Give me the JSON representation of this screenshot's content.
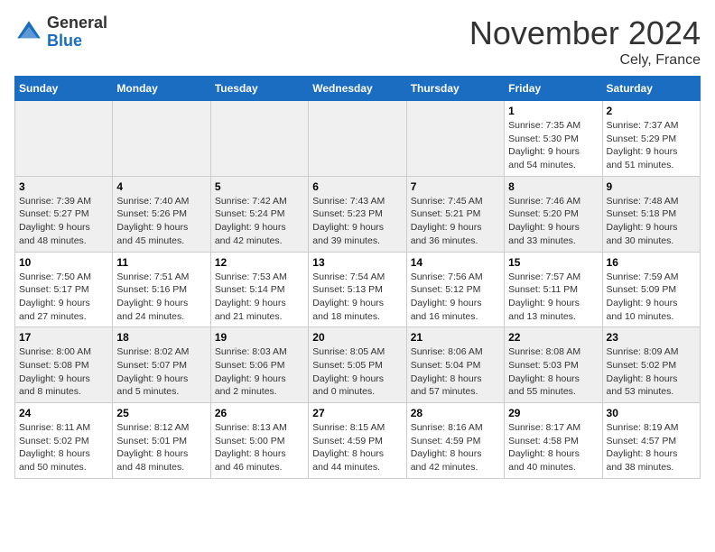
{
  "header": {
    "logo_general": "General",
    "logo_blue": "Blue",
    "month": "November 2024",
    "location": "Cely, France"
  },
  "days_of_week": [
    "Sunday",
    "Monday",
    "Tuesday",
    "Wednesday",
    "Thursday",
    "Friday",
    "Saturday"
  ],
  "weeks": [
    [
      {
        "day": "",
        "info": ""
      },
      {
        "day": "",
        "info": ""
      },
      {
        "day": "",
        "info": ""
      },
      {
        "day": "",
        "info": ""
      },
      {
        "day": "",
        "info": ""
      },
      {
        "day": "1",
        "info": "Sunrise: 7:35 AM\nSunset: 5:30 PM\nDaylight: 9 hours\nand 54 minutes."
      },
      {
        "day": "2",
        "info": "Sunrise: 7:37 AM\nSunset: 5:29 PM\nDaylight: 9 hours\nand 51 minutes."
      }
    ],
    [
      {
        "day": "3",
        "info": "Sunrise: 7:39 AM\nSunset: 5:27 PM\nDaylight: 9 hours\nand 48 minutes."
      },
      {
        "day": "4",
        "info": "Sunrise: 7:40 AM\nSunset: 5:26 PM\nDaylight: 9 hours\nand 45 minutes."
      },
      {
        "day": "5",
        "info": "Sunrise: 7:42 AM\nSunset: 5:24 PM\nDaylight: 9 hours\nand 42 minutes."
      },
      {
        "day": "6",
        "info": "Sunrise: 7:43 AM\nSunset: 5:23 PM\nDaylight: 9 hours\nand 39 minutes."
      },
      {
        "day": "7",
        "info": "Sunrise: 7:45 AM\nSunset: 5:21 PM\nDaylight: 9 hours\nand 36 minutes."
      },
      {
        "day": "8",
        "info": "Sunrise: 7:46 AM\nSunset: 5:20 PM\nDaylight: 9 hours\nand 33 minutes."
      },
      {
        "day": "9",
        "info": "Sunrise: 7:48 AM\nSunset: 5:18 PM\nDaylight: 9 hours\nand 30 minutes."
      }
    ],
    [
      {
        "day": "10",
        "info": "Sunrise: 7:50 AM\nSunset: 5:17 PM\nDaylight: 9 hours\nand 27 minutes."
      },
      {
        "day": "11",
        "info": "Sunrise: 7:51 AM\nSunset: 5:16 PM\nDaylight: 9 hours\nand 24 minutes."
      },
      {
        "day": "12",
        "info": "Sunrise: 7:53 AM\nSunset: 5:14 PM\nDaylight: 9 hours\nand 21 minutes."
      },
      {
        "day": "13",
        "info": "Sunrise: 7:54 AM\nSunset: 5:13 PM\nDaylight: 9 hours\nand 18 minutes."
      },
      {
        "day": "14",
        "info": "Sunrise: 7:56 AM\nSunset: 5:12 PM\nDaylight: 9 hours\nand 16 minutes."
      },
      {
        "day": "15",
        "info": "Sunrise: 7:57 AM\nSunset: 5:11 PM\nDaylight: 9 hours\nand 13 minutes."
      },
      {
        "day": "16",
        "info": "Sunrise: 7:59 AM\nSunset: 5:09 PM\nDaylight: 9 hours\nand 10 minutes."
      }
    ],
    [
      {
        "day": "17",
        "info": "Sunrise: 8:00 AM\nSunset: 5:08 PM\nDaylight: 9 hours\nand 8 minutes."
      },
      {
        "day": "18",
        "info": "Sunrise: 8:02 AM\nSunset: 5:07 PM\nDaylight: 9 hours\nand 5 minutes."
      },
      {
        "day": "19",
        "info": "Sunrise: 8:03 AM\nSunset: 5:06 PM\nDaylight: 9 hours\nand 2 minutes."
      },
      {
        "day": "20",
        "info": "Sunrise: 8:05 AM\nSunset: 5:05 PM\nDaylight: 9 hours\nand 0 minutes."
      },
      {
        "day": "21",
        "info": "Sunrise: 8:06 AM\nSunset: 5:04 PM\nDaylight: 8 hours\nand 57 minutes."
      },
      {
        "day": "22",
        "info": "Sunrise: 8:08 AM\nSunset: 5:03 PM\nDaylight: 8 hours\nand 55 minutes."
      },
      {
        "day": "23",
        "info": "Sunrise: 8:09 AM\nSunset: 5:02 PM\nDaylight: 8 hours\nand 53 minutes."
      }
    ],
    [
      {
        "day": "24",
        "info": "Sunrise: 8:11 AM\nSunset: 5:02 PM\nDaylight: 8 hours\nand 50 minutes."
      },
      {
        "day": "25",
        "info": "Sunrise: 8:12 AM\nSunset: 5:01 PM\nDaylight: 8 hours\nand 48 minutes."
      },
      {
        "day": "26",
        "info": "Sunrise: 8:13 AM\nSunset: 5:00 PM\nDaylight: 8 hours\nand 46 minutes."
      },
      {
        "day": "27",
        "info": "Sunrise: 8:15 AM\nSunset: 4:59 PM\nDaylight: 8 hours\nand 44 minutes."
      },
      {
        "day": "28",
        "info": "Sunrise: 8:16 AM\nSunset: 4:59 PM\nDaylight: 8 hours\nand 42 minutes."
      },
      {
        "day": "29",
        "info": "Sunrise: 8:17 AM\nSunset: 4:58 PM\nDaylight: 8 hours\nand 40 minutes."
      },
      {
        "day": "30",
        "info": "Sunrise: 8:19 AM\nSunset: 4:57 PM\nDaylight: 8 hours\nand 38 minutes."
      }
    ]
  ]
}
